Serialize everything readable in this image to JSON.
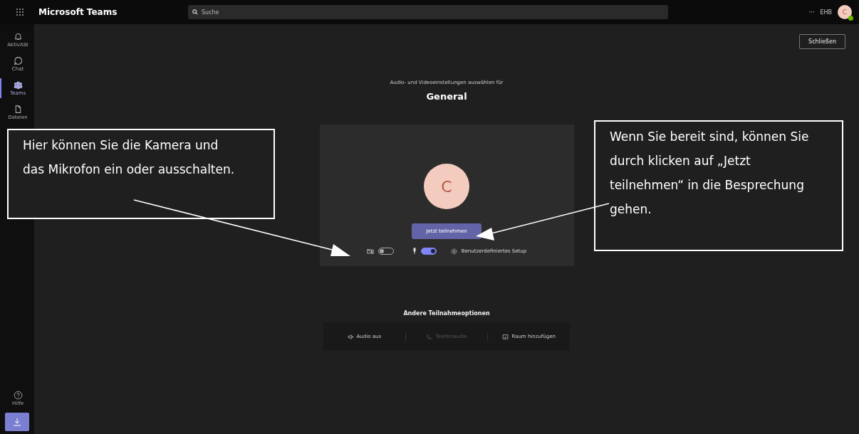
{
  "app": {
    "title": "Microsoft Teams",
    "search": {
      "placeholder": "Suche"
    },
    "more": "···",
    "initials": "EHB",
    "avatar": "C"
  },
  "rail": {
    "items": [
      {
        "label": "Aktivität",
        "kind": "bell",
        "selected": false
      },
      {
        "label": "Chat",
        "kind": "chat",
        "selected": false
      },
      {
        "label": "Teams",
        "kind": "teams",
        "selected": true
      },
      {
        "label": "Dateien",
        "kind": "file",
        "selected": false
      }
    ],
    "help": "Hilfe"
  },
  "close_button": "Schließen",
  "prejoin": {
    "subtitle": "Audio- und Videoeinstellungen auswählen für",
    "title": "General",
    "avatar": "C",
    "join_button": "Jetzt teilnehmen",
    "camera": {
      "on": false
    },
    "microphone": {
      "on": true
    },
    "setup": "Benutzerdefiniertes Setup"
  },
  "other_options": {
    "title": "Andere Teilnahmeoptionen",
    "options": [
      {
        "label": "Audio aus",
        "kind": "speaker",
        "disabled": false
      },
      {
        "label": "Telefonaudio",
        "kind": "phone",
        "disabled": true
      },
      {
        "label": "Raum hinzufügen",
        "kind": "room",
        "disabled": false
      }
    ]
  },
  "callouts": [
    {
      "text": "Hier können Sie die Kamera und das Mikrofon ein oder ausschalten."
    },
    {
      "text": "Wenn Sie bereit sind, können Sie durch klicken auf „Jetzt teilnehmen“ in die Besprechung gehen."
    }
  ]
}
